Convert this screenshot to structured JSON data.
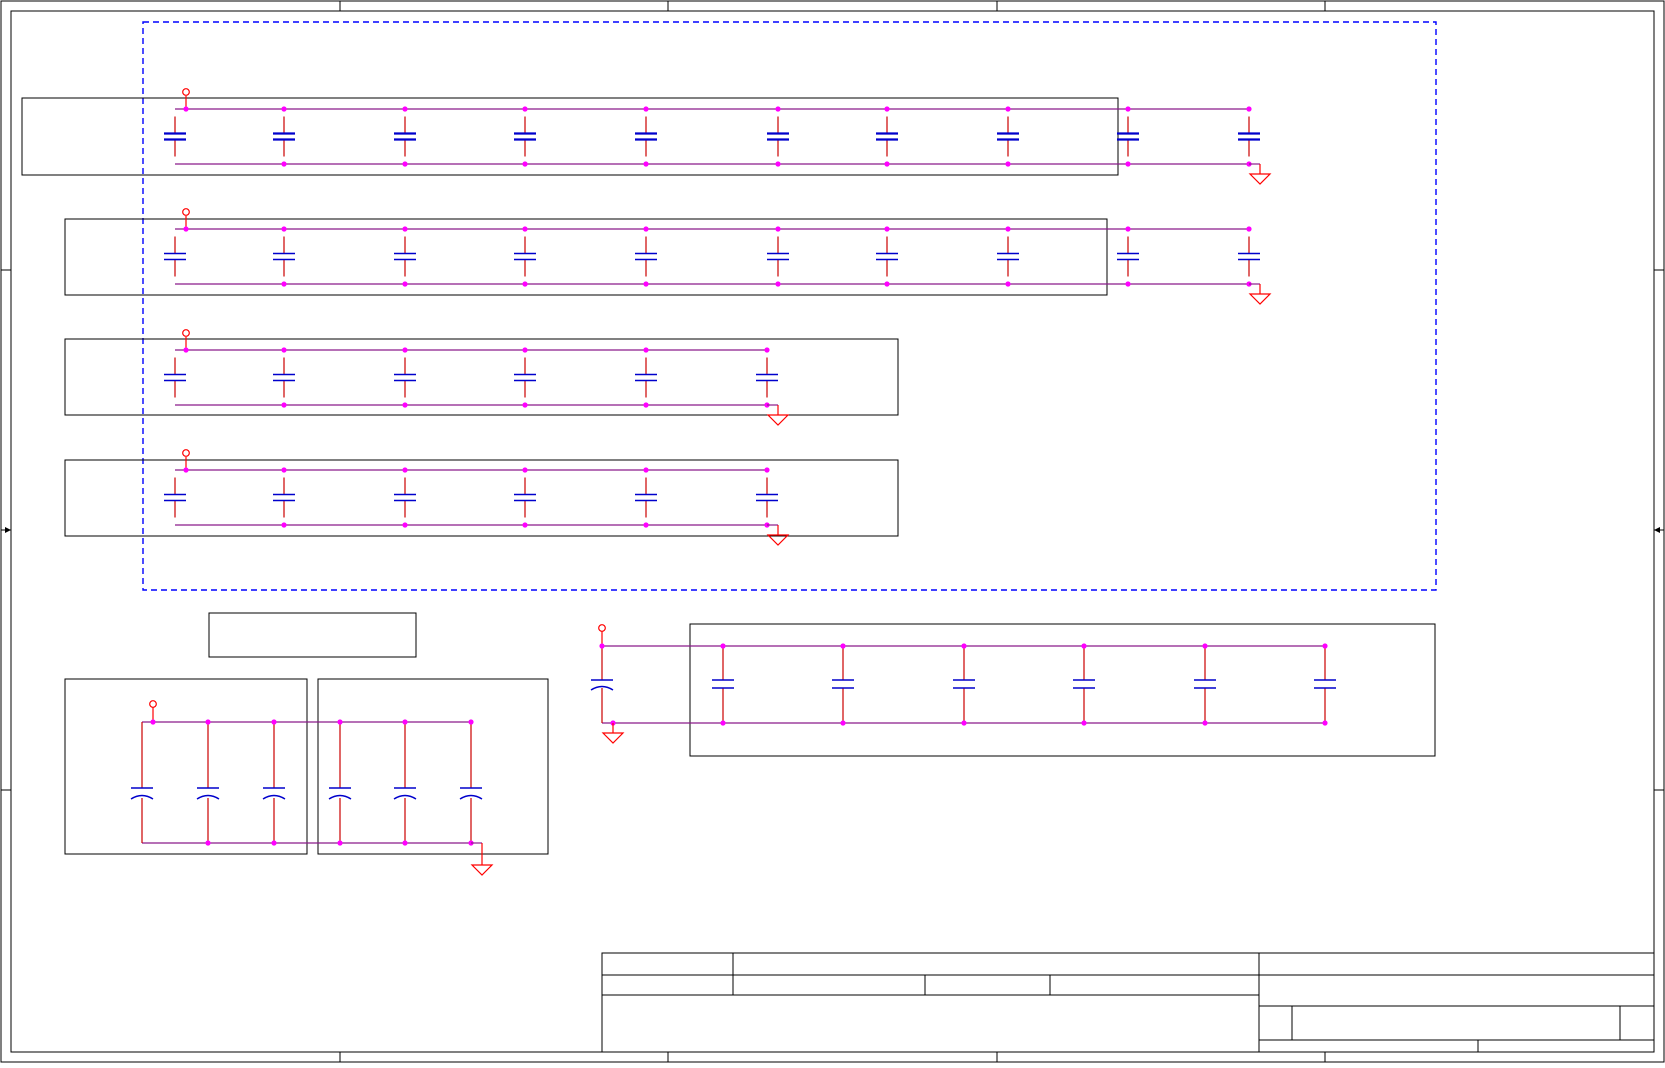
{
  "sheet": {
    "title": "",
    "colors": {
      "border": "#000000",
      "wire": "#cc0000",
      "net": "#8b1a8b",
      "junction": "#ff00ff",
      "capacitor": "#0000cc",
      "power": "#ff0000",
      "group_outline": "#0000ff"
    },
    "title_block": {
      "title": "",
      "size": "",
      "document_number": "",
      "rev": "",
      "date": "",
      "sheet_of": ""
    }
  },
  "decoupling_rows": [
    {
      "id": "row-1",
      "capacitors": 10,
      "capacitor_style": "polar"
    },
    {
      "id": "row-2",
      "capacitors": 10,
      "capacitor_style": "nonpolar"
    },
    {
      "id": "row-3",
      "capacitors": 6,
      "capacitor_style": "nonpolar"
    },
    {
      "id": "row-4",
      "capacitors": 6,
      "capacitor_style": "nonpolar"
    },
    {
      "id": "row-5",
      "capacitors": 7,
      "capacitor_style": "mixed"
    },
    {
      "id": "row-6",
      "capacitors": 6,
      "capacitor_style": "electrolytic"
    }
  ]
}
